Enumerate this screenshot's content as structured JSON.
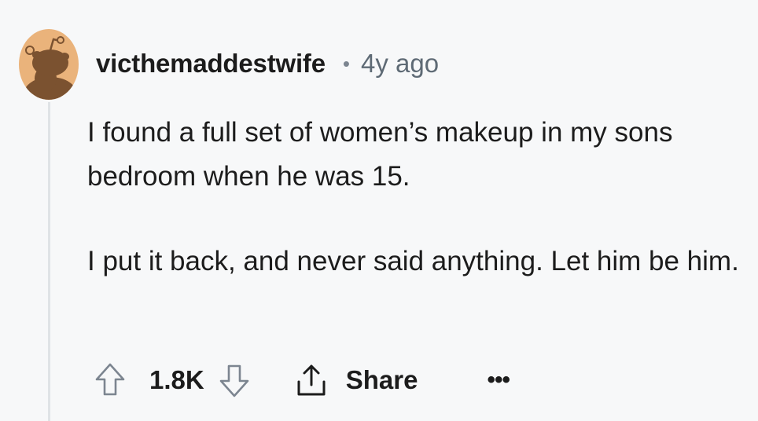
{
  "comment": {
    "username": "victhemaddestwife",
    "separator": "•",
    "time": "4y ago",
    "paragraphs": [
      "I found a full set of women’s makeup in my sons bedroom when he was 15.",
      "I put it back, and never said anything. Let him be him."
    ],
    "vote_count": "1.8K",
    "share_label": "Share",
    "more_label": "•••"
  },
  "icons": {
    "avatar": "snoo-avatar-icon",
    "upvote": "upvote-arrow-icon",
    "downvote": "downvote-arrow-icon",
    "share": "share-icon"
  },
  "colors": {
    "background": "#f7f8f9",
    "avatar_bg": "#eab37b",
    "snoo": "#7b5230",
    "thread_line": "#dfe3e6",
    "meta_text": "#5e6a75"
  }
}
